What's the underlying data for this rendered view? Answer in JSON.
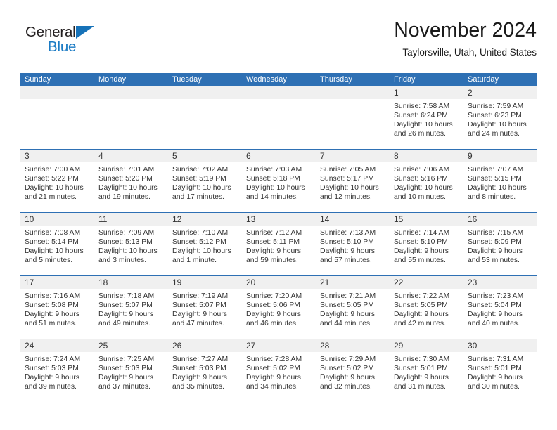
{
  "brand": {
    "name_part1": "General",
    "name_part2": "Blue",
    "accent_color": "#1b7bc4"
  },
  "header": {
    "title": "November 2024",
    "subtitle": "Taylorsville, Utah, United States"
  },
  "theme": {
    "header_blue": "#2e70b4",
    "daynum_band": "#f0f0f0",
    "text": "#333333"
  },
  "weekday_headers": [
    "Sunday",
    "Monday",
    "Tuesday",
    "Wednesday",
    "Thursday",
    "Friday",
    "Saturday"
  ],
  "labels": {
    "sunrise": "Sunrise:",
    "sunset": "Sunset:",
    "daylight": "Daylight:"
  },
  "weeks": [
    [
      {
        "empty": true
      },
      {
        "empty": true
      },
      {
        "empty": true
      },
      {
        "empty": true
      },
      {
        "empty": true
      },
      {
        "day": "1",
        "sunrise": "Sunrise: 7:58 AM",
        "sunset": "Sunset: 6:24 PM",
        "daylight": "Daylight: 10 hours and 26 minutes."
      },
      {
        "day": "2",
        "sunrise": "Sunrise: 7:59 AM",
        "sunset": "Sunset: 6:23 PM",
        "daylight": "Daylight: 10 hours and 24 minutes."
      }
    ],
    [
      {
        "day": "3",
        "sunrise": "Sunrise: 7:00 AM",
        "sunset": "Sunset: 5:22 PM",
        "daylight": "Daylight: 10 hours and 21 minutes."
      },
      {
        "day": "4",
        "sunrise": "Sunrise: 7:01 AM",
        "sunset": "Sunset: 5:20 PM",
        "daylight": "Daylight: 10 hours and 19 minutes."
      },
      {
        "day": "5",
        "sunrise": "Sunrise: 7:02 AM",
        "sunset": "Sunset: 5:19 PM",
        "daylight": "Daylight: 10 hours and 17 minutes."
      },
      {
        "day": "6",
        "sunrise": "Sunrise: 7:03 AM",
        "sunset": "Sunset: 5:18 PM",
        "daylight": "Daylight: 10 hours and 14 minutes."
      },
      {
        "day": "7",
        "sunrise": "Sunrise: 7:05 AM",
        "sunset": "Sunset: 5:17 PM",
        "daylight": "Daylight: 10 hours and 12 minutes."
      },
      {
        "day": "8",
        "sunrise": "Sunrise: 7:06 AM",
        "sunset": "Sunset: 5:16 PM",
        "daylight": "Daylight: 10 hours and 10 minutes."
      },
      {
        "day": "9",
        "sunrise": "Sunrise: 7:07 AM",
        "sunset": "Sunset: 5:15 PM",
        "daylight": "Daylight: 10 hours and 8 minutes."
      }
    ],
    [
      {
        "day": "10",
        "sunrise": "Sunrise: 7:08 AM",
        "sunset": "Sunset: 5:14 PM",
        "daylight": "Daylight: 10 hours and 5 minutes."
      },
      {
        "day": "11",
        "sunrise": "Sunrise: 7:09 AM",
        "sunset": "Sunset: 5:13 PM",
        "daylight": "Daylight: 10 hours and 3 minutes."
      },
      {
        "day": "12",
        "sunrise": "Sunrise: 7:10 AM",
        "sunset": "Sunset: 5:12 PM",
        "daylight": "Daylight: 10 hours and 1 minute."
      },
      {
        "day": "13",
        "sunrise": "Sunrise: 7:12 AM",
        "sunset": "Sunset: 5:11 PM",
        "daylight": "Daylight: 9 hours and 59 minutes."
      },
      {
        "day": "14",
        "sunrise": "Sunrise: 7:13 AM",
        "sunset": "Sunset: 5:10 PM",
        "daylight": "Daylight: 9 hours and 57 minutes."
      },
      {
        "day": "15",
        "sunrise": "Sunrise: 7:14 AM",
        "sunset": "Sunset: 5:10 PM",
        "daylight": "Daylight: 9 hours and 55 minutes."
      },
      {
        "day": "16",
        "sunrise": "Sunrise: 7:15 AM",
        "sunset": "Sunset: 5:09 PM",
        "daylight": "Daylight: 9 hours and 53 minutes."
      }
    ],
    [
      {
        "day": "17",
        "sunrise": "Sunrise: 7:16 AM",
        "sunset": "Sunset: 5:08 PM",
        "daylight": "Daylight: 9 hours and 51 minutes."
      },
      {
        "day": "18",
        "sunrise": "Sunrise: 7:18 AM",
        "sunset": "Sunset: 5:07 PM",
        "daylight": "Daylight: 9 hours and 49 minutes."
      },
      {
        "day": "19",
        "sunrise": "Sunrise: 7:19 AM",
        "sunset": "Sunset: 5:07 PM",
        "daylight": "Daylight: 9 hours and 47 minutes."
      },
      {
        "day": "20",
        "sunrise": "Sunrise: 7:20 AM",
        "sunset": "Sunset: 5:06 PM",
        "daylight": "Daylight: 9 hours and 46 minutes."
      },
      {
        "day": "21",
        "sunrise": "Sunrise: 7:21 AM",
        "sunset": "Sunset: 5:05 PM",
        "daylight": "Daylight: 9 hours and 44 minutes."
      },
      {
        "day": "22",
        "sunrise": "Sunrise: 7:22 AM",
        "sunset": "Sunset: 5:05 PM",
        "daylight": "Daylight: 9 hours and 42 minutes."
      },
      {
        "day": "23",
        "sunrise": "Sunrise: 7:23 AM",
        "sunset": "Sunset: 5:04 PM",
        "daylight": "Daylight: 9 hours and 40 minutes."
      }
    ],
    [
      {
        "day": "24",
        "sunrise": "Sunrise: 7:24 AM",
        "sunset": "Sunset: 5:03 PM",
        "daylight": "Daylight: 9 hours and 39 minutes."
      },
      {
        "day": "25",
        "sunrise": "Sunrise: 7:25 AM",
        "sunset": "Sunset: 5:03 PM",
        "daylight": "Daylight: 9 hours and 37 minutes."
      },
      {
        "day": "26",
        "sunrise": "Sunrise: 7:27 AM",
        "sunset": "Sunset: 5:03 PM",
        "daylight": "Daylight: 9 hours and 35 minutes."
      },
      {
        "day": "27",
        "sunrise": "Sunrise: 7:28 AM",
        "sunset": "Sunset: 5:02 PM",
        "daylight": "Daylight: 9 hours and 34 minutes."
      },
      {
        "day": "28",
        "sunrise": "Sunrise: 7:29 AM",
        "sunset": "Sunset: 5:02 PM",
        "daylight": "Daylight: 9 hours and 32 minutes."
      },
      {
        "day": "29",
        "sunrise": "Sunrise: 7:30 AM",
        "sunset": "Sunset: 5:01 PM",
        "daylight": "Daylight: 9 hours and 31 minutes."
      },
      {
        "day": "30",
        "sunrise": "Sunrise: 7:31 AM",
        "sunset": "Sunset: 5:01 PM",
        "daylight": "Daylight: 9 hours and 30 minutes."
      }
    ]
  ]
}
